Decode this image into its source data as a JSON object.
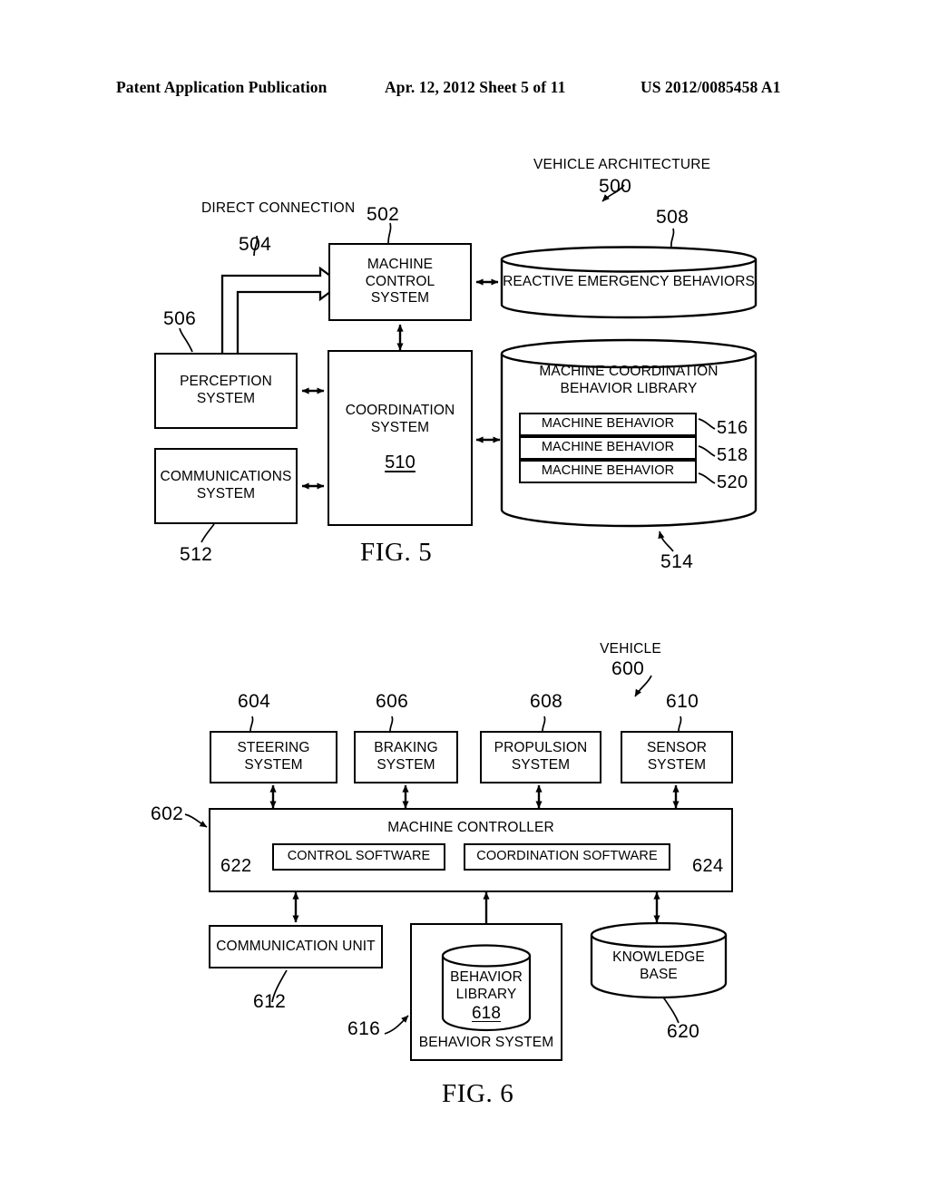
{
  "header": {
    "left": "Patent Application Publication",
    "middle": "Apr. 12, 2012  Sheet 5 of 11",
    "right": "US 2012/0085458 A1"
  },
  "fig5": {
    "caption": "FIG. 5",
    "title_label": "VEHICLE ARCHITECTURE",
    "title_ref": "500",
    "direct_connection": {
      "label_line1": "DIRECT",
      "label_line2": "CONNECTION",
      "ref": "504"
    },
    "machine_control_system": {
      "line1": "MACHINE",
      "line2": "CONTROL",
      "line3": "SYSTEM",
      "ref": "502"
    },
    "perception_system": {
      "line1": "PERCEPTION",
      "line2": "SYSTEM",
      "ref": "506"
    },
    "communications_system": {
      "line1": "COMMUNICATIONS",
      "line2": "SYSTEM",
      "ref": "512"
    },
    "coordination_system": {
      "line1": "COORDINATION",
      "line2": "SYSTEM",
      "ref": "510"
    },
    "reactive_emergency_behaviors": {
      "label": "REACTIVE EMERGENCY BEHAVIORS",
      "ref": "508"
    },
    "behavior_library": {
      "line1": "MACHINE COORDINATION",
      "line2": "BEHAVIOR LIBRARY",
      "ref": "514",
      "items": [
        {
          "label": "MACHINE BEHAVIOR",
          "ref": "516"
        },
        {
          "label": "MACHINE BEHAVIOR",
          "ref": "518"
        },
        {
          "label": "MACHINE BEHAVIOR",
          "ref": "520"
        }
      ]
    }
  },
  "fig6": {
    "caption": "FIG. 6",
    "title_label": "VEHICLE",
    "title_ref": "600",
    "top_systems": [
      {
        "line1": "STEERING",
        "line2": "SYSTEM",
        "ref": "604"
      },
      {
        "line1": "BRAKING",
        "line2": "SYSTEM",
        "ref": "606"
      },
      {
        "line1": "PROPULSION",
        "line2": "SYSTEM",
        "ref": "608"
      },
      {
        "line1": "SENSOR",
        "line2": "SYSTEM",
        "ref": "610"
      }
    ],
    "machine_controller": {
      "title": "MACHINE CONTROLLER",
      "ref": "602",
      "control_software": {
        "label": "CONTROL SOFTWARE",
        "ref": "622"
      },
      "coordination_software": {
        "label": "COORDINATION SOFTWARE",
        "ref": "624"
      }
    },
    "communication_unit": {
      "label": "COMMUNICATION UNIT",
      "ref": "612"
    },
    "behavior_system": {
      "label": "BEHAVIOR SYSTEM",
      "ref": "616",
      "library": {
        "line1": "BEHAVIOR",
        "line2": "LIBRARY",
        "ref": "618"
      }
    },
    "knowledge_base": {
      "line1": "KNOWLEDGE",
      "line2": "BASE",
      "ref": "620"
    }
  }
}
